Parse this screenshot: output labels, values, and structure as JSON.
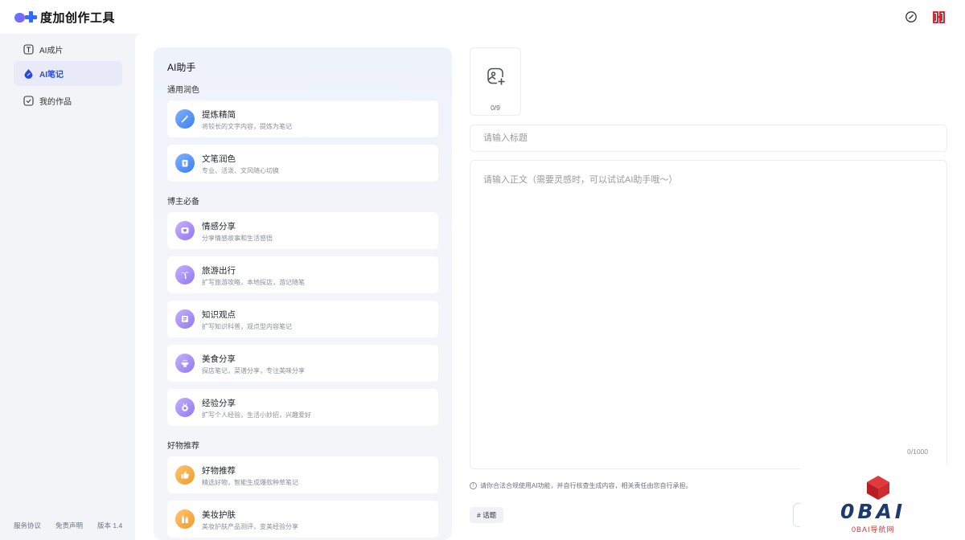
{
  "app": {
    "title": "度加创作工具"
  },
  "sidebar": {
    "items": [
      {
        "label": "AI成片",
        "icon": "template-icon",
        "active": false
      },
      {
        "label": "AI笔记",
        "icon": "droplet-icon",
        "active": true
      },
      {
        "label": "我的作品",
        "icon": "check-box-icon",
        "active": false
      }
    ],
    "footer": [
      "服务协议",
      "免责声明",
      "版本 1.4"
    ]
  },
  "ai_panel": {
    "title": "AI助手",
    "sections": [
      {
        "title": "通用润色",
        "cards": [
          {
            "title": "提炼精简",
            "desc": "将较长的文字内容，提炼为笔记",
            "icon": "magic-wand-icon",
            "color": "blue"
          },
          {
            "title": "文笔润色",
            "desc": "专业、活泼、文风随心切换",
            "icon": "paint-bucket-icon",
            "color": "blue"
          }
        ]
      },
      {
        "title": "博主必备",
        "cards": [
          {
            "title": "情感分享",
            "desc": "分享情感故事和生活感悟",
            "icon": "heart-chat-icon",
            "color": "purple"
          },
          {
            "title": "旅游出行",
            "desc": "扩写旅游攻略，本地探店，游记随笔",
            "icon": "palm-tree-icon",
            "color": "purple"
          },
          {
            "title": "知识观点",
            "desc": "扩写知识科普，观点型内容笔记",
            "icon": "document-icon",
            "color": "purple"
          },
          {
            "title": "美食分享",
            "desc": "探店笔记，菜谱分享，专注美味分享",
            "icon": "food-bowl-icon",
            "color": "purple"
          },
          {
            "title": "经验分享",
            "desc": "扩写个人经验，生活小妙招，兴趣爱好",
            "icon": "medal-icon",
            "color": "purple"
          }
        ]
      },
      {
        "title": "好物推荐",
        "cards": [
          {
            "title": "好物推荐",
            "desc": "精选好物，智能生成爆款种草笔记",
            "icon": "thumbs-up-icon",
            "color": "orange"
          },
          {
            "title": "美妆护肤",
            "desc": "美妆护肤产品测评，变美经验分享",
            "icon": "cosmetics-icon",
            "color": "orange"
          }
        ]
      }
    ]
  },
  "editor": {
    "image_count": "0/9",
    "title_placeholder": "请输入标题",
    "body_placeholder": "请输入正文（需要灵感时，可以试试AI助手哦～）",
    "char_count": "0/1000",
    "notice": "请你合法合规使用AI功能，并自行核查生成内容，相关责任由您自行承担。",
    "topic_label": "# 话题"
  },
  "watermark": {
    "brand": "0BAI",
    "subtitle": "0BAI导航网"
  },
  "colors": {
    "accent": "#2a4bd7",
    "brand_blue": "#2f6bff",
    "watermark_red": "#d23434"
  }
}
